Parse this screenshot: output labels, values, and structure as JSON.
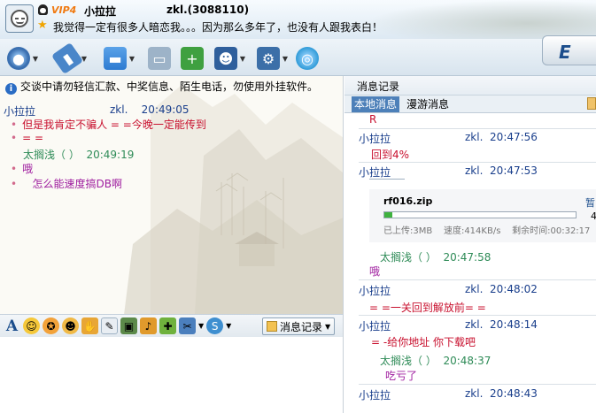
{
  "header": {
    "vip_label": "VIP4",
    "nickname": "小拉拉",
    "account": "zkl.(3088110)",
    "signature": "我觉得一定有很多人暗恋我。。。因为那么多年了，也没有人跟我表白！"
  },
  "toolbar": {
    "buttons": [
      {
        "icon": "video-camera-icon",
        "color": "#3a6fb0"
      },
      {
        "icon": "microphone-icon",
        "color": "#4a86c9"
      },
      {
        "icon": "folder-icon",
        "color": "#2e7bd1"
      },
      {
        "icon": "screen-share-icon",
        "color": "#9db3c8"
      },
      {
        "icon": "add-contact-icon",
        "color": "#3fa040"
      },
      {
        "icon": "user-manage-icon",
        "color": "#2f5f9c"
      },
      {
        "icon": "settings-icon",
        "color": "#3c6fa8"
      },
      {
        "icon": "app-icon",
        "color": "#2f9bd8"
      }
    ],
    "banner_text": "E"
  },
  "chat": {
    "notice": "交谈中请勿轻信汇款、中奖信息、陌生电话，勿使用外挂软件。",
    "messages": [
      {
        "sender": "小拉拉",
        "account": "zkl.",
        "time": "20:49:05"
      },
      {
        "text": "但是我肯定不骗人 = =今晚一定能传到",
        "color": "#c8102e"
      },
      {
        "text": "= =",
        "color": "#c8102e"
      },
      {
        "sender": "太搁浅（ ）",
        "time": "20:49:19",
        "color": "#2e8b57"
      },
      {
        "text": "哦",
        "color": "#a020a0"
      },
      {
        "text": "怎么能速度搞DB啊",
        "color": "#a020a0"
      }
    ]
  },
  "input_toolbar": {
    "font_label": "A",
    "message_record_label": "消息记录"
  },
  "history": {
    "title": "消息记录",
    "tab_local": "本地消息",
    "tab_roam": "漫游消息",
    "entries": [
      {
        "text": "R",
        "color": "#c8102e"
      },
      {
        "sender": "小拉拉",
        "account": "zkl.",
        "time": "20:47:56"
      },
      {
        "text": "回到4%",
        "color": "#c8102e"
      },
      {
        "sender": "小拉拉",
        "account": "zkl.",
        "time": "20:47:53"
      },
      {
        "sender": "太搁浅（ ）",
        "time": "20:47:58",
        "color": "#2e8b57"
      },
      {
        "text": "哦",
        "color": "#a020a0"
      },
      {
        "sender": "小拉拉",
        "account": "zkl.",
        "time": "20:48:02"
      },
      {
        "text": "= =一关回到解放前= =",
        "color": "#c8102e"
      },
      {
        "sender": "小拉拉",
        "account": "zkl.",
        "time": "20:48:14"
      },
      {
        "text": "= -给你地址 你下载吧",
        "color": "#c8102e"
      },
      {
        "sender": "太搁浅（ ）",
        "time": "20:48:37",
        "color": "#2e8b57"
      },
      {
        "text": "吃亏了",
        "color": "#a020a0"
      },
      {
        "sender": "小拉拉",
        "account": "zkl.",
        "time": "20:48:43"
      }
    ],
    "file": {
      "name": "rf016.zip",
      "progress": 0.04,
      "uploaded": "已上传:3MB",
      "speed": "速度:414KB/s",
      "remaining": "剩余时间:00:32:17",
      "side_label": "暂",
      "side_number": "4"
    }
  },
  "colors": {
    "sender_blue": "#1a3f8c",
    "accent": "#4d80b9"
  }
}
